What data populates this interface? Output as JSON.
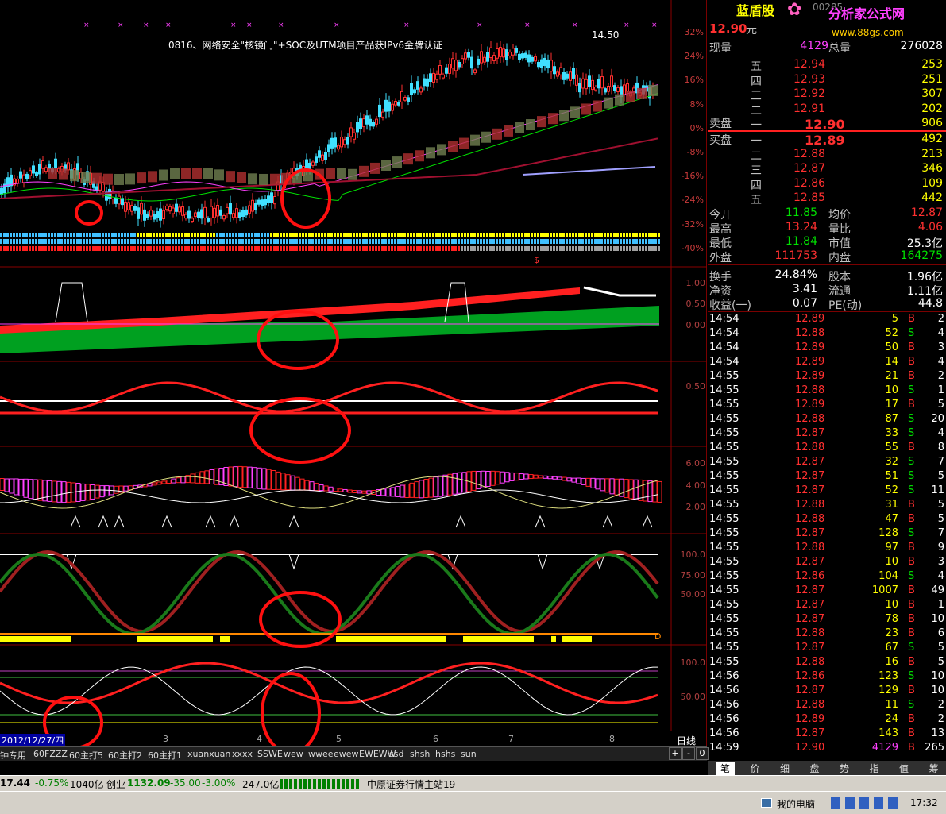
{
  "news": "0816、网络安全\"核镜门\"+SOC及UTM项目产品获IPv6金牌认证",
  "high_label": "14.50",
  "date_label": "2012/12/27/四",
  "period": "日线",
  "pct_ticks": [
    "32%",
    "24%",
    "16%",
    "8%",
    "0%",
    "-8%",
    "-16%",
    "-24%",
    "-32%",
    "-40%"
  ],
  "ind1_ticks": [
    "1.00",
    "0.50",
    "0.00"
  ],
  "ind2_ticks": [
    "0.50"
  ],
  "ind3_ticks": [
    "6.00",
    "4.00",
    "2.00"
  ],
  "ind4_ticks": [
    "100.0",
    "75.00",
    "50.00"
  ],
  "ind5_ticks": [
    "100.0",
    "50.00"
  ],
  "x_labels": [
    "3",
    "4",
    "5",
    "6",
    "7",
    "8"
  ],
  "ind4_side": "D",
  "dollar": "$",
  "stock_name": "蓝盾股",
  "logo": "分析家公式网",
  "logo_url": "www.88gs.com",
  "code_partial": "00285",
  "price": "12.90",
  "price_unit": "元",
  "vol_now_label": "现量",
  "vol_now": "4129",
  "vol_total_label": "总量",
  "vol_total": "276028",
  "sell_label": "卖盘",
  "buy_label": "买盘",
  "asks": [
    {
      "lv": "五",
      "p": "12.94",
      "v": "253"
    },
    {
      "lv": "四",
      "p": "12.93",
      "v": "251"
    },
    {
      "lv": "三",
      "p": "12.92",
      "v": "307"
    },
    {
      "lv": "二",
      "p": "12.91",
      "v": "202"
    },
    {
      "lv": "一",
      "p": "12.90",
      "v": "906"
    }
  ],
  "bids": [
    {
      "lv": "一",
      "p": "12.89",
      "v": "492"
    },
    {
      "lv": "二",
      "p": "12.88",
      "v": "213"
    },
    {
      "lv": "三",
      "p": "12.87",
      "v": "346"
    },
    {
      "lv": "四",
      "p": "12.86",
      "v": "109"
    },
    {
      "lv": "五",
      "p": "12.85",
      "v": "442"
    }
  ],
  "stats": [
    {
      "l1": "今开",
      "v1": "11.85",
      "c1": "grn",
      "l2": "均价",
      "v2": "12.87",
      "c2": "red"
    },
    {
      "l1": "最高",
      "v1": "13.24",
      "c1": "red",
      "l2": "量比",
      "v2": "4.06",
      "c2": "red"
    },
    {
      "l1": "最低",
      "v1": "11.84",
      "c1": "grn",
      "l2": "市值",
      "v2": "25.3亿",
      "c2": "wht"
    },
    {
      "l1": "外盘",
      "v1": "111753",
      "c1": "red",
      "l2": "内盘",
      "v2": "164275",
      "c2": "grn"
    }
  ],
  "stats2": [
    {
      "l1": "换手",
      "v1": "24.84%",
      "l2": "股本",
      "v2": "1.96亿"
    },
    {
      "l1": "净资",
      "v1": "3.41",
      "l2": "流通",
      "v2": "1.11亿"
    },
    {
      "l1": "收益(一)",
      "v1": "0.07",
      "l2": "PE(动)",
      "v2": "44.8"
    }
  ],
  "ticks": [
    [
      "14:54",
      "12.89",
      "5",
      "B",
      "2"
    ],
    [
      "14:54",
      "12.88",
      "52",
      "S",
      "4"
    ],
    [
      "14:54",
      "12.89",
      "50",
      "B",
      "3"
    ],
    [
      "14:54",
      "12.89",
      "14",
      "B",
      "4"
    ],
    [
      "14:55",
      "12.89",
      "21",
      "B",
      "2"
    ],
    [
      "14:55",
      "12.88",
      "10",
      "S",
      "1"
    ],
    [
      "14:55",
      "12.89",
      "17",
      "B",
      "5"
    ],
    [
      "14:55",
      "12.88",
      "87",
      "S",
      "20"
    ],
    [
      "14:55",
      "12.87",
      "33",
      "S",
      "4"
    ],
    [
      "14:55",
      "12.88",
      "55",
      "B",
      "8"
    ],
    [
      "14:55",
      "12.87",
      "32",
      "S",
      "7"
    ],
    [
      "14:55",
      "12.87",
      "51",
      "S",
      "5"
    ],
    [
      "14:55",
      "12.87",
      "52",
      "S",
      "11"
    ],
    [
      "14:55",
      "12.88",
      "31",
      "B",
      "5"
    ],
    [
      "14:55",
      "12.88",
      "47",
      "B",
      "5"
    ],
    [
      "14:55",
      "12.87",
      "128",
      "S",
      "7"
    ],
    [
      "14:55",
      "12.88",
      "97",
      "B",
      "9"
    ],
    [
      "14:55",
      "12.87",
      "10",
      "B",
      "3"
    ],
    [
      "14:55",
      "12.86",
      "104",
      "S",
      "4"
    ],
    [
      "14:55",
      "12.87",
      "1007",
      "B",
      "49"
    ],
    [
      "14:55",
      "12.87",
      "10",
      "B",
      "1"
    ],
    [
      "14:55",
      "12.87",
      "78",
      "B",
      "10"
    ],
    [
      "14:55",
      "12.88",
      "23",
      "B",
      "6"
    ],
    [
      "14:55",
      "12.87",
      "67",
      "S",
      "5"
    ],
    [
      "14:55",
      "12.88",
      "16",
      "B",
      "5"
    ],
    [
      "14:56",
      "12.86",
      "123",
      "S",
      "10"
    ],
    [
      "14:56",
      "12.87",
      "129",
      "B",
      "10"
    ],
    [
      "14:56",
      "12.88",
      "11",
      "S",
      "2"
    ],
    [
      "14:56",
      "12.89",
      "24",
      "B",
      "2"
    ],
    [
      "14:56",
      "12.87",
      "143",
      "B",
      "13"
    ],
    [
      "14:59",
      "12.90",
      "4129",
      "B",
      "265"
    ]
  ],
  "bottom_tabs": [
    "钟专用",
    "60FZZZ",
    "60主打5",
    "60主打2",
    "60主打1",
    "xuanxuan",
    "xxxx",
    "SSWE",
    "wew",
    "wwee",
    "ewew",
    "EWEWW",
    "ssd",
    "shsh",
    "hshs",
    "sun"
  ],
  "nav_btns": [
    "+",
    "-",
    "0"
  ],
  "right_tabs": [
    "笔",
    "价",
    "细",
    "盘",
    "势",
    "指",
    "值",
    "筹"
  ],
  "status": {
    "idx1": "17.44",
    "idx1_chg": "-0.75%",
    "idx1_amt": "1040亿",
    "cy_label": "创业",
    "cy": "1132.09",
    "cy_chg": "-35.00",
    "cy_pct": "-3.00%",
    "cy_amt": "247.0亿",
    "server": "中原证券行情主站19"
  },
  "taskbar": {
    "mycomputer": "我的电脑",
    "time": "17:32"
  }
}
